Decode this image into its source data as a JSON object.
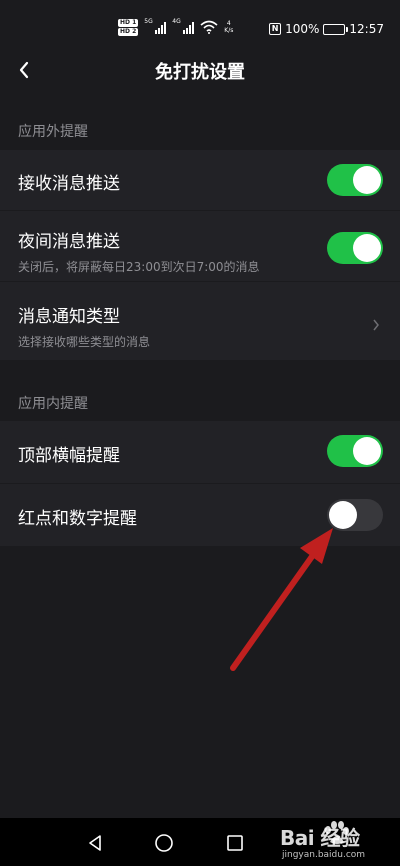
{
  "status_bar": {
    "hd1": "HD 1",
    "hd2": "HD 2",
    "net1": "5G",
    "net2": "4G",
    "speed_value": "4",
    "speed_unit": "K/s",
    "nfc": "N",
    "battery": "100%",
    "time": "12:57"
  },
  "header": {
    "title": "免打扰设置",
    "back_icon": "chevron-left-icon"
  },
  "sections": {
    "outside": {
      "label": "应用外提醒",
      "items": [
        {
          "title": "接收消息推送",
          "subtitle": "",
          "control": "toggle",
          "enabled": true
        },
        {
          "title": "夜间消息推送",
          "subtitle": "关闭后，将屏蔽每日23:00到次日7:00的消息",
          "control": "toggle",
          "enabled": true
        },
        {
          "title": "消息通知类型",
          "subtitle": "选择接收哪些类型的消息",
          "control": "chevron",
          "enabled": null
        }
      ]
    },
    "inside": {
      "label": "应用内提醒",
      "items": [
        {
          "title": "顶部横幅提醒",
          "subtitle": "",
          "control": "toggle",
          "enabled": true
        },
        {
          "title": "红点和数字提醒",
          "subtitle": "",
          "control": "toggle",
          "enabled": false
        }
      ]
    }
  },
  "nav_bar": {
    "back": "triangle-back-icon",
    "home": "circle-home-icon",
    "recents": "square-recents-icon"
  },
  "watermark": {
    "brand": "Bai  经验",
    "url": "jingyan.baidu.com"
  },
  "colors": {
    "background": "#1b1b1e",
    "row": "#222226",
    "toggle_on": "#20c148",
    "toggle_off": "#38383c",
    "annotation_arrow": "#c0201f"
  }
}
